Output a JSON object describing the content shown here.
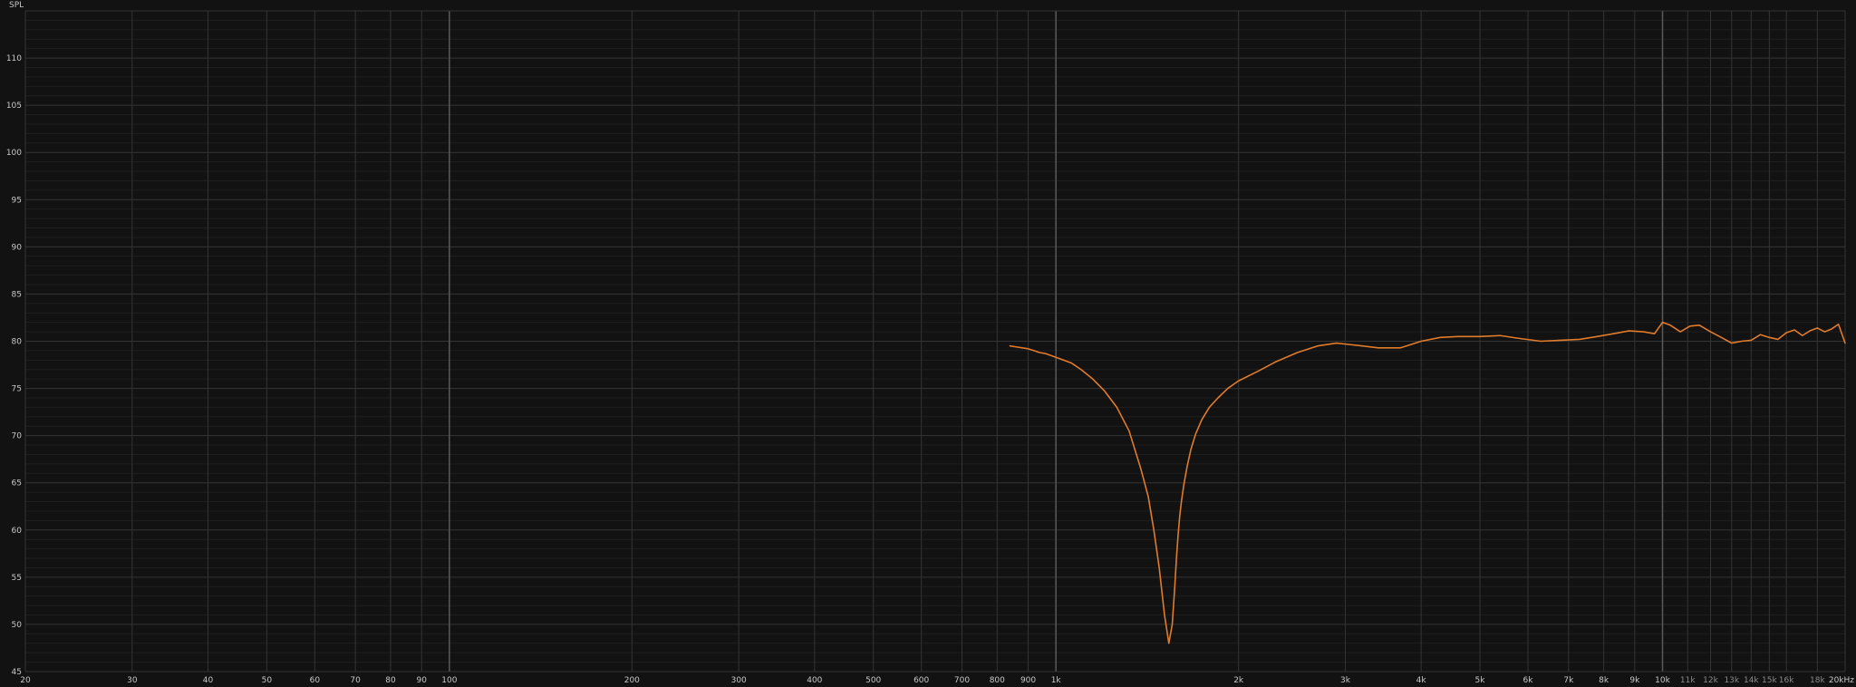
{
  "chart_data": {
    "type": "line",
    "ylabel": "SPL",
    "x_scale": "log",
    "xlim": [
      20,
      20000
    ],
    "ylim": [
      45,
      115
    ],
    "grid": true,
    "colors": {
      "background": "#121212",
      "grid_minor": "#1f1f1f",
      "grid_major": "#343434",
      "grid_decade": "#5a5a5a",
      "series": "#e07b2a",
      "text": "#c8c8c8",
      "text_minor": "#8a8a8a"
    },
    "x_ticks": [
      {
        "value": 20,
        "label": "20"
      },
      {
        "value": 30,
        "label": "30"
      },
      {
        "value": 40,
        "label": "40"
      },
      {
        "value": 50,
        "label": "50"
      },
      {
        "value": 60,
        "label": "60"
      },
      {
        "value": 70,
        "label": "70"
      },
      {
        "value": 80,
        "label": "80"
      },
      {
        "value": 90,
        "label": "90"
      },
      {
        "value": 100,
        "label": "100"
      },
      {
        "value": 200,
        "label": "200"
      },
      {
        "value": 300,
        "label": "300"
      },
      {
        "value": 400,
        "label": "400"
      },
      {
        "value": 500,
        "label": "500"
      },
      {
        "value": 600,
        "label": "600"
      },
      {
        "value": 700,
        "label": "700"
      },
      {
        "value": 800,
        "label": "800"
      },
      {
        "value": 900,
        "label": "900"
      },
      {
        "value": 1000,
        "label": "1k"
      },
      {
        "value": 2000,
        "label": "2k"
      },
      {
        "value": 3000,
        "label": "3k"
      },
      {
        "value": 4000,
        "label": "4k"
      },
      {
        "value": 5000,
        "label": "5k"
      },
      {
        "value": 6000,
        "label": "6k"
      },
      {
        "value": 7000,
        "label": "7k"
      },
      {
        "value": 8000,
        "label": "8k"
      },
      {
        "value": 9000,
        "label": "9k"
      },
      {
        "value": 10000,
        "label": "10k"
      },
      {
        "value": 11000,
        "label": "11k",
        "minor": true
      },
      {
        "value": 12000,
        "label": "12k",
        "minor": true
      },
      {
        "value": 13000,
        "label": "13k",
        "minor": true
      },
      {
        "value": 14000,
        "label": "14k",
        "minor": true
      },
      {
        "value": 15000,
        "label": "15k",
        "minor": true
      },
      {
        "value": 16000,
        "label": "16k",
        "minor": true
      },
      {
        "value": 18000,
        "label": "18k",
        "minor": true
      },
      {
        "value": 20000,
        "label": "20kHz"
      }
    ],
    "y_ticks": [
      45,
      50,
      55,
      60,
      65,
      70,
      75,
      80,
      85,
      90,
      95,
      100,
      105,
      110
    ],
    "series": [
      {
        "x": [
          840,
          860,
          880,
          900,
          920,
          940,
          960,
          980,
          1000,
          1030,
          1060,
          1100,
          1150,
          1200,
          1260,
          1320,
          1380,
          1420,
          1450,
          1480,
          1510,
          1535,
          1555,
          1570,
          1580,
          1590,
          1600,
          1610,
          1625,
          1645,
          1670,
          1700,
          1740,
          1790,
          1850,
          1920,
          2000,
          2150,
          2300,
          2500,
          2700,
          2900,
          3000,
          3200,
          3400,
          3700,
          4000,
          4300,
          4600,
          5000,
          5400,
          5800,
          6300,
          6800,
          7300,
          7800,
          8300,
          8800,
          9300,
          9700,
          10000,
          10300,
          10700,
          11100,
          11500,
          12000,
          12500,
          13000,
          13500,
          14000,
          14500,
          15000,
          15500,
          16000,
          16500,
          17000,
          17500,
          18000,
          18500,
          19000,
          19500,
          20000
        ],
        "y": [
          79.5,
          79.4,
          79.3,
          79.2,
          79.0,
          78.8,
          78.7,
          78.5,
          78.3,
          78.0,
          77.7,
          77.0,
          76.0,
          74.8,
          73.0,
          70.5,
          66.5,
          63.5,
          60.0,
          56.0,
          51.0,
          48.0,
          50.0,
          54.0,
          57.0,
          59.5,
          61.5,
          63.0,
          64.8,
          66.7,
          68.6,
          70.2,
          71.7,
          73.0,
          74.0,
          75.0,
          75.8,
          76.8,
          77.8,
          78.8,
          79.5,
          79.8,
          79.7,
          79.5,
          79.3,
          79.3,
          80.0,
          80.4,
          80.5,
          80.5,
          80.6,
          80.3,
          80.0,
          80.1,
          80.2,
          80.5,
          80.8,
          81.1,
          81.0,
          80.8,
          82.0,
          81.7,
          81.0,
          81.6,
          81.7,
          81.0,
          80.4,
          79.8,
          80.0,
          80.1,
          80.7,
          80.4,
          80.2,
          80.9,
          81.2,
          80.6,
          81.1,
          81.4,
          81.0,
          81.3,
          81.8,
          79.8
        ]
      }
    ]
  }
}
